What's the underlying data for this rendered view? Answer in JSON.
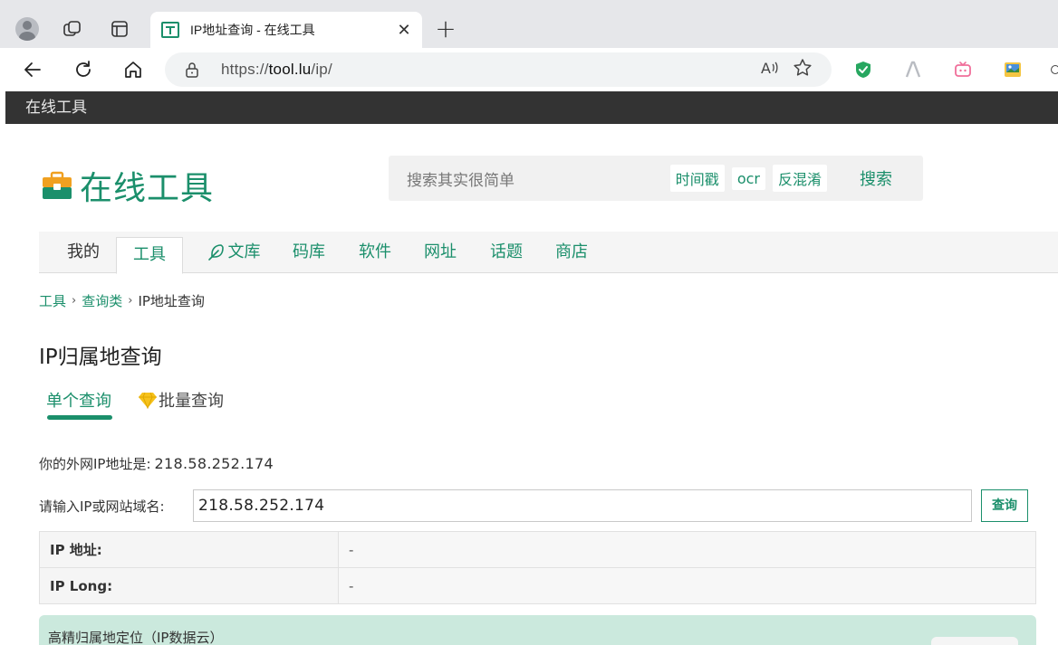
{
  "browser": {
    "tab_title": "IP地址查询 - 在线工具",
    "tab_close": "✕",
    "newtab": "+",
    "url_prefix": "https://",
    "url_host": "tool.lu",
    "url_path": "/ip/",
    "read_aloud": "A)"
  },
  "site": {
    "strip_title": "在线工具",
    "brand": "在线工具",
    "search_placeholder": "搜索其实很简单",
    "chips": [
      "时间戳",
      "ocr",
      "反混淆"
    ],
    "search_button": "搜索"
  },
  "nav": [
    {
      "label": "我的"
    },
    {
      "label": "工具",
      "active": true
    },
    {
      "label": "文库"
    },
    {
      "label": "码库"
    },
    {
      "label": "软件"
    },
    {
      "label": "网址"
    },
    {
      "label": "话题"
    },
    {
      "label": "商店"
    }
  ],
  "breadcrumb": {
    "items": [
      "工具",
      "查询类",
      "IP地址查询"
    ],
    "sep": "›"
  },
  "main": {
    "title": "IP归属地查询",
    "tab_single": "单个查询",
    "tab_batch": "批量查询",
    "myip_label": "你的外网IP地址是:",
    "myip_value": "218.58.252.174",
    "input_label": "请输入IP或网站域名:",
    "input_value": "218.58.252.174",
    "query_button": "查询",
    "rows": [
      {
        "key": "IP 地址:",
        "value": "-"
      },
      {
        "key": "IP Long:",
        "value": "-"
      }
    ],
    "cloud_title": "高精归属地定位（IP数据云）"
  },
  "colors": {
    "accent": "#1b8f6b",
    "strip": "#333333",
    "cloud_bg": "#cbe9dd"
  }
}
